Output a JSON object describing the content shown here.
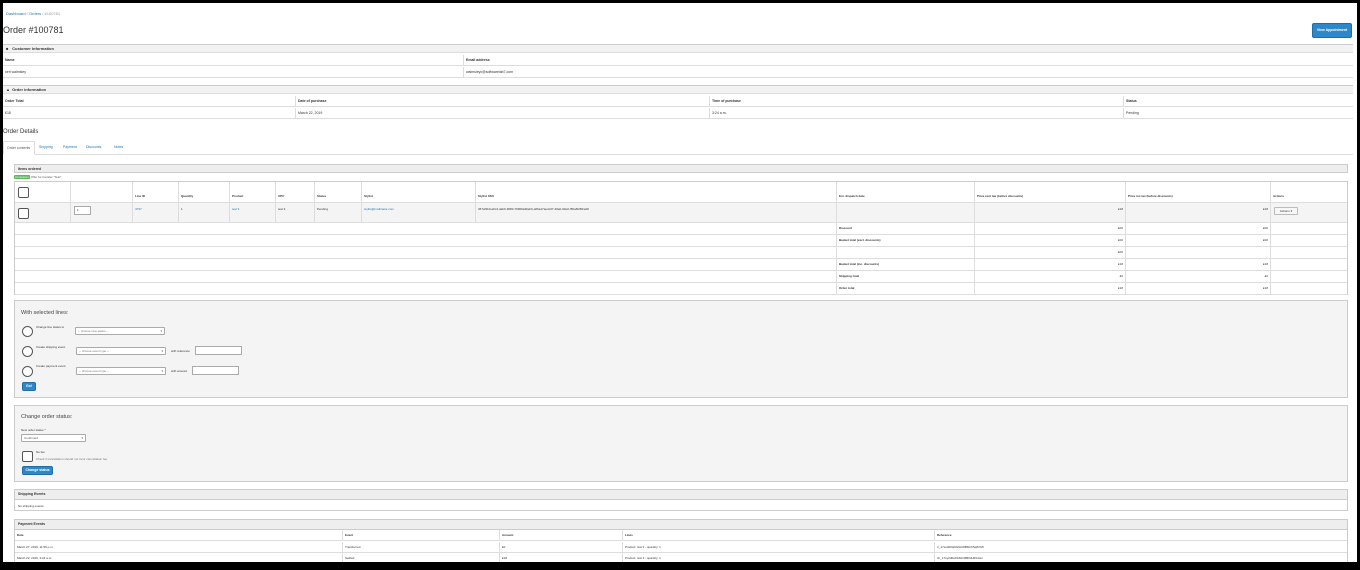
{
  "breadcrumb": {
    "items": [
      "Dashboard",
      "Orders"
    ],
    "current": "#100781"
  },
  "page": {
    "title": "Order #100781",
    "view_appointment_label": "View Appointment"
  },
  "customer": {
    "heading": "Customer Information",
    "name_label": "Name",
    "email_label": "Email address",
    "name_value": "ceri walmsley",
    "email_value": "walmsleyc@softwarelab7.com"
  },
  "order_info": {
    "heading": "Order information",
    "headers": [
      "Order Total",
      "Date of purchase",
      "Time of purchase",
      "Status"
    ],
    "values": [
      "£18",
      "March 22, 2019",
      "3:24 a.m.",
      "Pending"
    ]
  },
  "order_details": {
    "heading": "Order Details",
    "tabs": [
      "Order contents",
      "Shipping",
      "Payment",
      "Discounts",
      "Notes"
    ]
  },
  "items": {
    "heading": "Items ordered",
    "consumer_tag": "Consumer",
    "consumer_text": "Offer for transfer \"Test\"",
    "headers": [
      "",
      "",
      "Line ID",
      "Quantity",
      "Product",
      "UPC",
      "Status",
      "Stylist",
      "Stylist SKU",
      "Est. dispatch date",
      "Price excl tax (before discounts)",
      "Price inc tax (before discounts)",
      "Actions"
    ],
    "row": {
      "qty_input": "1",
      "line_id": "4797",
      "quantity": "1",
      "product": "test 3",
      "upc": "test 3",
      "status": "Pending",
      "stylist": "stylist@mailinator.com",
      "sku": "367af3b0-a6c4-4ab9-9080-79969a39eb0-a66a17ae4c07-46ab-90e0-f56a6f28fca00",
      "price_excl": "£18",
      "price_inc": "£18",
      "actions_label": "Actions"
    },
    "totals": [
      {
        "label": "Discount",
        "excl": "£00",
        "inc": "£00"
      },
      {
        "label": "Basket total (excl. discounts)",
        "excl": "£00",
        "inc": "£00"
      },
      {
        "label": "",
        "excl": "£00",
        "inc": ""
      },
      {
        "label": "Basket total (inc. discounts)",
        "excl": "£18",
        "inc": "£18"
      },
      {
        "label": "Shipping total",
        "excl": "£0",
        "inc": "£0"
      },
      {
        "label": "Order total",
        "excl": "£18",
        "inc": "£18"
      }
    ]
  },
  "selected_lines": {
    "title": "With selected lines:",
    "change_status_label": "Change line status to",
    "status_placeholder": "-- choose new status --",
    "shipping_label": "Create shipping event",
    "shipping_placeholder": "-- choose event type --",
    "with_reference": "with reference",
    "payment_label": "Create payment event",
    "payment_placeholder": "-- choose event type --",
    "with_amount": "with amount",
    "go_label": "Go!"
  },
  "change_status": {
    "title": "Change order status:",
    "new_status_label": "New order status *",
    "new_status_value": "Confirmed",
    "no_fee_label": "No fee",
    "no_fee_help": "Check if cancellation should not incur cancellation fee",
    "button_label": "Change status"
  },
  "shipping_events": {
    "heading": "Shipping Events",
    "empty": "No shipping events."
  },
  "payment_events": {
    "heading": "Payment Events",
    "headers": [
      "Date",
      "Event",
      "Amount",
      "Lines",
      "Reference"
    ],
    "rows": [
      [
        "March 27, 2019, 11:59 p.m.",
        "Transferred",
        "£0",
        "Product: test 3 - quantity: 1",
        "tr_17ss3d0sK0ZHC8BMzC5q8rXW"
      ],
      [
        "March 22, 2019, 3:24 a.m.",
        "Settled",
        "£18",
        "Product: test 3 - quantity: 1",
        "ch_17sy0d0sK0ZHC8B0JH6Xdom"
      ]
    ]
  }
}
